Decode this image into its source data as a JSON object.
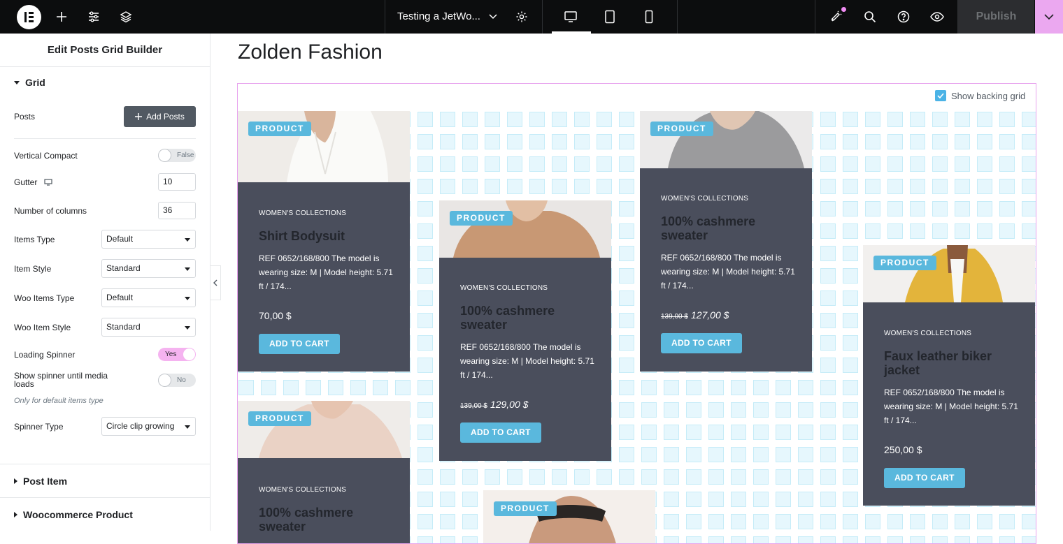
{
  "topbar": {
    "doc_title": "Testing a JetWo...",
    "publish_label": "Publish",
    "accent": "#eba8f0"
  },
  "panel": {
    "header": "Edit Posts Grid Builder",
    "grid_section": "Grid",
    "posts_label": "Posts",
    "add_posts_label": "Add Posts",
    "vertical_compact_label": "Vertical Compact",
    "vertical_compact_value": "False",
    "gutter_label": "Gutter",
    "gutter_value": "10",
    "columns_label": "Number of columns",
    "columns_value": "36",
    "items_type_label": "Items Type",
    "items_type_value": "Default",
    "item_style_label": "Item Style",
    "item_style_value": "Standard",
    "woo_items_type_label": "Woo Items Type",
    "woo_items_type_value": "Default",
    "woo_item_style_label": "Woo Item Style",
    "woo_item_style_value": "Standard",
    "loading_spinner_label": "Loading Spinner",
    "loading_spinner_value": "Yes",
    "spinner_media_label": "Show spinner until media loads",
    "spinner_media_value": "No",
    "spinner_note": "Only for default items type",
    "spinner_type_label": "Spinner Type",
    "spinner_type_value": "Circle clip growing",
    "post_item_section": "Post Item",
    "woo_section": "Woocommerce Product"
  },
  "canvas": {
    "page_title": "Zolden Fashion",
    "show_backing_grid": "Show backing grid"
  },
  "cards": [
    {
      "badge": "PRODUCT",
      "category": "WOMEN'S COLLECTIONS",
      "title": "Shirt Bodysuit",
      "desc": "REF 0652/168/800 The model is wearing size: M | Model height: 5.71 ft / 174...",
      "old_price": "",
      "price": "70,00 $",
      "button": "ADD TO CART"
    },
    {
      "badge": "PRODUCT",
      "category": "WOMEN'S COLLECTIONS",
      "title": "100% cashmere sweater",
      "desc": "REF 0652/168/800 The model is wearing size: M | Model height: 5.71 ft / 174...",
      "old_price": "139,00 $",
      "price": "129,00 $",
      "button": "ADD TO CART"
    },
    {
      "badge": "PRODUCT",
      "category": "WOMEN'S COLLECTIONS",
      "title": "100% cashmere sweater",
      "desc": "REF 0652/168/800 The model is wearing size: M | Model height: 5.71 ft / 174...",
      "old_price": "139,00 $",
      "price": "127,00 $",
      "button": "ADD TO CART"
    },
    {
      "badge": "PRODUCT",
      "category": "WOMEN'S COLLECTIONS",
      "title": "Faux leather biker jacket",
      "desc": "REF 0652/168/800 The model is wearing size: M | Model height: 5.71 ft / 174...",
      "old_price": "",
      "price": "250,00 $",
      "button": "ADD TO CART"
    },
    {
      "badge": "PRODUCT",
      "category": "WOMEN'S COLLECTIONS",
      "title": "100% cashmere sweater"
    },
    {
      "badge": "PRODUCT"
    }
  ]
}
